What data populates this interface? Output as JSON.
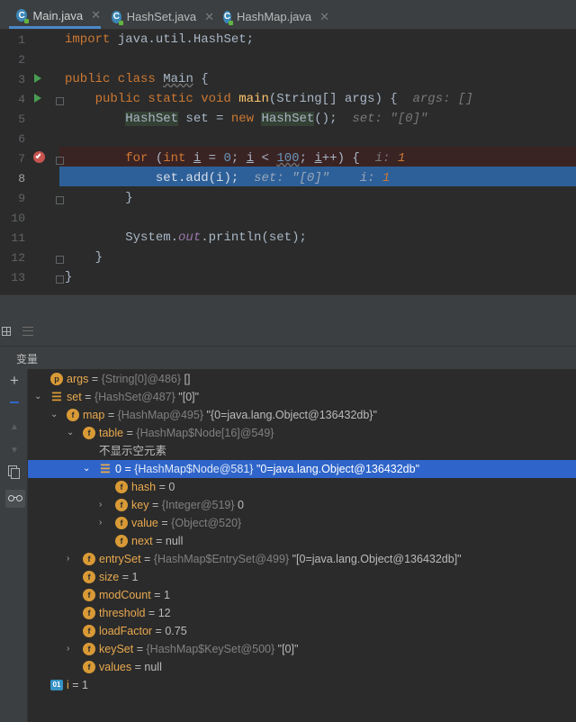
{
  "tabs": [
    {
      "label": "Main.java",
      "icon": "java-class-icon",
      "active": true
    },
    {
      "label": "HashSet.java",
      "icon": "java-class-icon",
      "active": false
    },
    {
      "label": "HashMap.java",
      "icon": "java-class-icon",
      "active": false
    }
  ],
  "editor": {
    "line_numbers": [
      "1",
      "2",
      "3",
      "4",
      "5",
      "6",
      "7",
      "8",
      "9",
      "10",
      "11",
      "12",
      "13"
    ],
    "line1": {
      "kw": "import",
      "rest": " java.util.HashSet;"
    },
    "line3": {
      "kw": "public class",
      "cls": "Main",
      "rest": " {"
    },
    "line4": {
      "kw": "public static void",
      "fn": "main",
      "rest": "(String[] args) {",
      "hint": "args: []"
    },
    "line5": {
      "t1": "HashSet",
      "t2": " set = ",
      "kw": "new",
      "t3": "HashSet",
      "t4": "();",
      "hint": "set: \"[0]\""
    },
    "line7": {
      "kw1": "for",
      "p1": " (",
      "kw2": "int",
      "p2": " ",
      "v1": "i",
      "p3": " = ",
      "n1": "0",
      "p4": "; ",
      "v2": "i",
      "p5": " < ",
      "n2": "100",
      "p6": "; ",
      "v3": "i",
      "p7": "++) {",
      "hint": "i:",
      "hintval": "1"
    },
    "line8": {
      "code": "set.add(i);",
      "hint1": "set: \"[0]\"",
      "hint2": "i:",
      "hint2val": "1"
    },
    "line9": {
      "code": "}"
    },
    "line11": {
      "p1": "System.",
      "italic": "out",
      "p2": ".println(set);"
    },
    "line12": {
      "code": "}"
    },
    "line13": {
      "code": "}"
    }
  },
  "variables_panel": {
    "title": "变量",
    "rows": [
      {
        "name": "args",
        "type": "{String[0]@486}",
        "value": "[]",
        "icon": "param-icon"
      },
      {
        "name": "set",
        "type": "{HashSet@487}",
        "value": "\"[0]\"",
        "icon": "local-var-icon"
      },
      {
        "name": "map",
        "type": "{HashMap@495}",
        "value": "\"{0=java.lang.Object@136432db}\"",
        "icon": "field-icon"
      },
      {
        "name": "table",
        "type": "{HashMap$Node[16]@549}",
        "value": "",
        "icon": "field-icon"
      },
      {
        "note": "不显示空元素"
      },
      {
        "name": "0",
        "type": "{HashMap$Node@581}",
        "value": "\"0=java.lang.Object@136432db\"",
        "icon": "array-element-icon",
        "selected": true
      },
      {
        "name": "hash",
        "eq": "= 0",
        "icon": "field-icon"
      },
      {
        "name": "key",
        "type": "{Integer@519}",
        "value": "0",
        "icon": "field-icon"
      },
      {
        "name": "value",
        "type": "{Object@520}",
        "value": "",
        "icon": "field-icon"
      },
      {
        "name": "next",
        "eq": "= null",
        "icon": "field-icon"
      },
      {
        "name": "entrySet",
        "type": "{HashMap$EntrySet@499}",
        "value": "\"[0=java.lang.Object@136432db]\"",
        "icon": "field-icon"
      },
      {
        "name": "size",
        "eq": "= 1",
        "icon": "field-icon"
      },
      {
        "name": "modCount",
        "eq": "= 1",
        "icon": "field-icon"
      },
      {
        "name": "threshold",
        "eq": "= 12",
        "icon": "field-icon"
      },
      {
        "name": "loadFactor",
        "eq": "= 0.75",
        "icon": "field-icon"
      },
      {
        "name": "keySet",
        "type": "{HashMap$KeySet@500}",
        "value": "\"[0]\"",
        "icon": "field-icon"
      },
      {
        "name": "values",
        "eq": "= null",
        "icon": "field-icon"
      },
      {
        "name": "i",
        "eq": "= 1",
        "icon": "primitive-var-icon"
      }
    ],
    "eq_sign": "="
  },
  "colors": {
    "background": "#2b2b2b",
    "keyword": "#cc7832",
    "selection": "#2f65ca",
    "breakpoint_line": "#3a2323"
  }
}
